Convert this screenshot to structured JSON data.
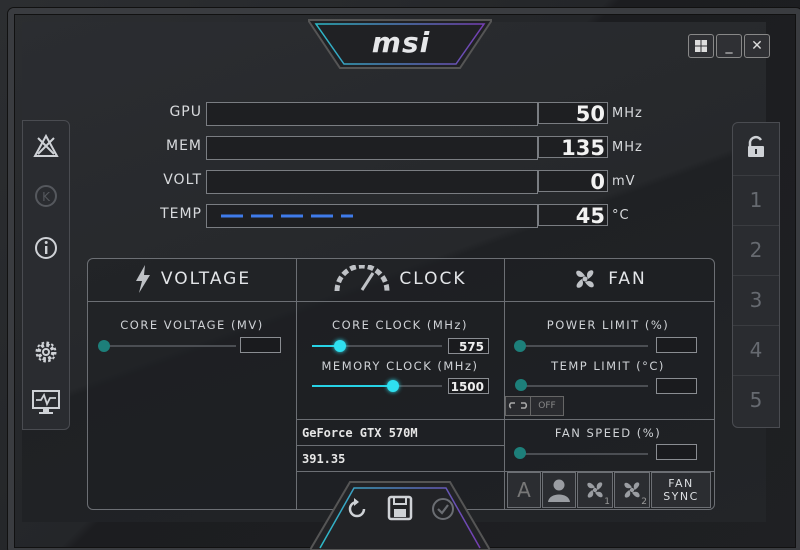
{
  "window": {
    "logo": "msi",
    "controls": [
      {
        "name": "windows-icon",
        "label": ""
      },
      {
        "name": "minimize",
        "label": "_"
      },
      {
        "name": "close",
        "label": "✕"
      }
    ]
  },
  "monitor": [
    {
      "label": "GPU",
      "value": "50",
      "unit": "MHz"
    },
    {
      "label": "MEM",
      "value": "135",
      "unit": "MHz"
    },
    {
      "label": "VOLT",
      "value": "0",
      "unit": "mV"
    },
    {
      "label": "TEMP",
      "value": "45",
      "unit": "°C"
    }
  ],
  "sections": {
    "voltage": {
      "title": "VOLTAGE",
      "core_voltage_label": "CORE VOLTAGE (MV)",
      "core_voltage_value": ""
    },
    "clock": {
      "title": "CLOCK",
      "core_clock_label": "CORE CLOCK (MHz)",
      "core_clock_value": "575",
      "memory_clock_label": "MEMORY CLOCK (MHz)",
      "memory_clock_value": "1500"
    },
    "fan": {
      "title": "FAN",
      "power_limit_label": "POWER LIMIT (%)",
      "power_limit_value": "",
      "temp_limit_label": "TEMP LIMIT (°C)",
      "temp_limit_value": "",
      "link_off_label": "OFF",
      "fan_speed_label": "FAN SPEED (%)",
      "fan_speed_value": "",
      "auto_label": "A",
      "fan1_sub": "1",
      "fan2_sub": "2",
      "fan_sync_label_1": "FAN",
      "fan_sync_label_2": "SYNC"
    }
  },
  "gpu_info": {
    "name": "GeForce GTX 570M",
    "driver": "391.35"
  },
  "profiles": [
    "1",
    "2",
    "3",
    "4",
    "5"
  ],
  "colors": {
    "accent": "#2fe0f0",
    "knob_inactive": "#1d7f7a",
    "notch_glow": "#7a4fd0"
  }
}
